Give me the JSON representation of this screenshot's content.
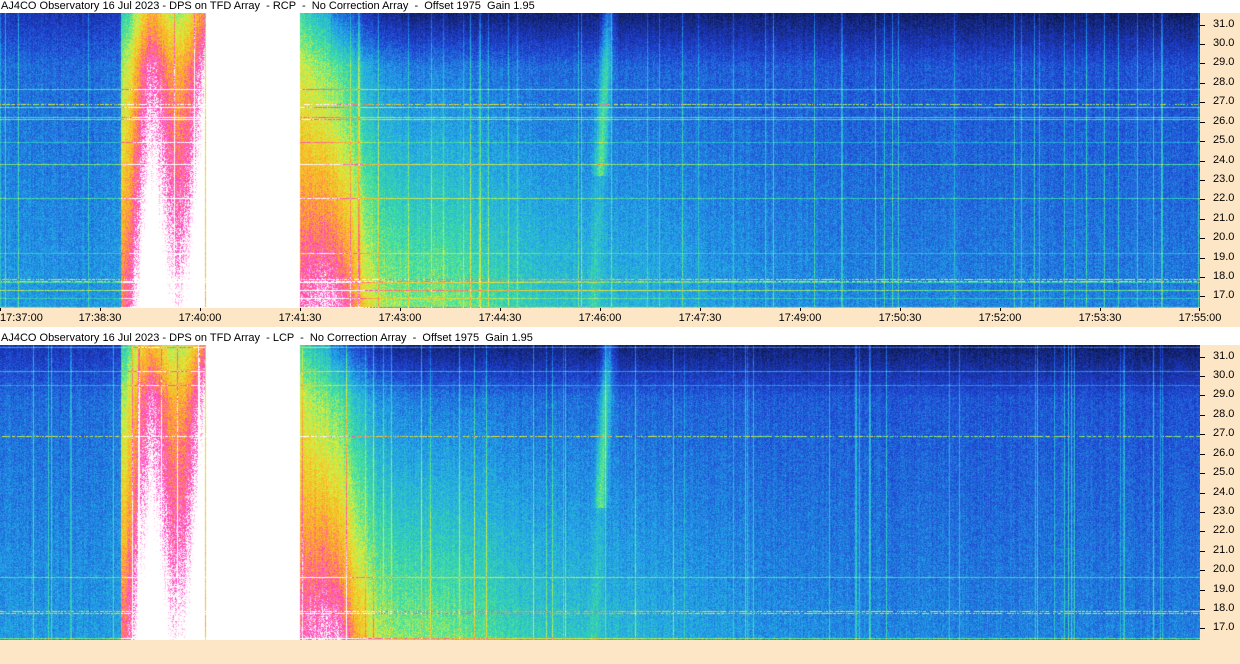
{
  "chart_data": [
    {
      "type": "heatmap",
      "title": "AJ4CO Observatory 16 Jul 2023 - DPS on TFD Array  - RCP  -  No Correction Array  -  Offset 1975  Gain 1.95",
      "x_ticks": [
        "17:37:00",
        "17:38:30",
        "17:40:00",
        "17:41:30",
        "17:43:00",
        "17:44:30",
        "17:46:00",
        "17:47:30",
        "17:49:00",
        "17:50:30",
        "17:52:00",
        "17:53:30",
        "17:55:00"
      ],
      "y_ticks": [
        "17.0",
        "18.0",
        "19.0",
        "20.0",
        "21.0",
        "22.0",
        "23.0",
        "24.0",
        "25.0",
        "26.0",
        "27.0",
        "28.0",
        "29.0",
        "30.0",
        "31.0"
      ],
      "ylim": [
        16.4,
        31.6
      ],
      "colormap": [
        "#0a1030",
        "#1f3fd0",
        "#22a8e8",
        "#3fe0a0",
        "#d8f040",
        "#ffb020",
        "#ff40c0",
        "#ffffff"
      ]
    },
    {
      "type": "heatmap",
      "title": "AJ4CO Observatory 16 Jul 2023 - DPS on TFD Array  - LCP  -  No Correction Array  -  Offset 1975  Gain 1.95",
      "x_ticks": [],
      "y_ticks": [
        "17.0",
        "18.0",
        "19.0",
        "20.0",
        "21.0",
        "22.0",
        "23.0",
        "24.0",
        "25.0",
        "26.0",
        "27.0",
        "28.0",
        "29.0",
        "30.0",
        "31.0"
      ],
      "ylim": [
        16.4,
        31.6
      ],
      "colormap": [
        "#0a1030",
        "#1f3fd0",
        "#22a8e8",
        "#3fe0a0",
        "#d8f040",
        "#ffb020",
        "#ff40c0",
        "#ffffff"
      ]
    }
  ]
}
